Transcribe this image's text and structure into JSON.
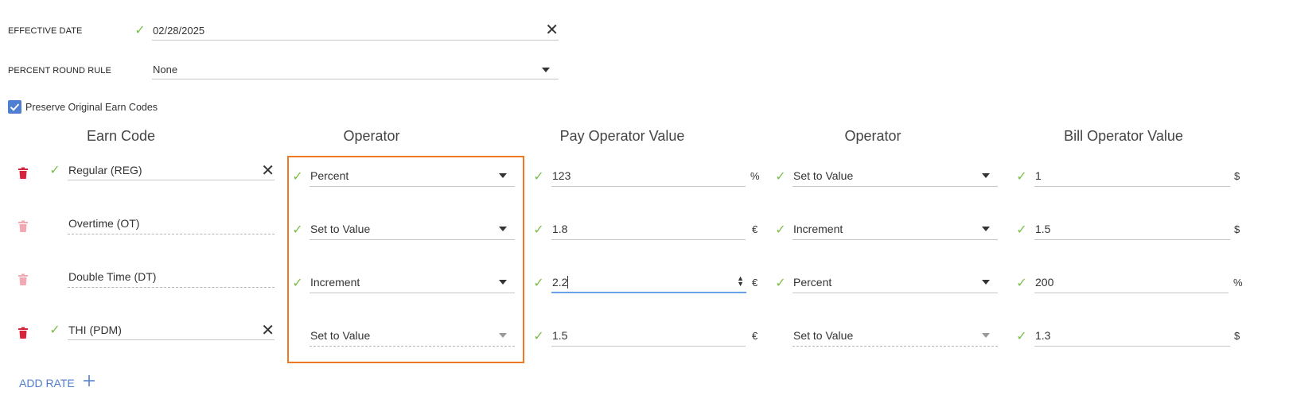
{
  "form": {
    "effective_date": {
      "label": "EFFECTIVE DATE",
      "value": "02/28/2025"
    },
    "percent_round_rule": {
      "label": "PERCENT ROUND RULE",
      "value": "None"
    },
    "preserve": {
      "label": "Preserve Original Earn Codes",
      "checked": true
    }
  },
  "headers": {
    "earn_code": "Earn Code",
    "operator_pay": "Operator",
    "pay_value": "Pay Operator Value",
    "operator_bill": "Operator",
    "bill_value": "Bill Operator Value"
  },
  "rows": [
    {
      "earn_code": "Regular (REG)",
      "pay_operator": "Percent",
      "pay_value": "123",
      "pay_unit": "%",
      "bill_operator": "Set to Value",
      "bill_value": "1",
      "bill_unit": "$"
    },
    {
      "earn_code": "Overtime (OT)",
      "pay_operator": "Set to Value",
      "pay_value": "1.8",
      "pay_unit": "€",
      "bill_operator": "Increment",
      "bill_value": "1.5",
      "bill_unit": "$"
    },
    {
      "earn_code": "Double Time (DT)",
      "pay_operator": "Increment",
      "pay_value": "2.2",
      "pay_unit": "€",
      "bill_operator": "Percent",
      "bill_value": "200",
      "bill_unit": "%"
    },
    {
      "earn_code": "THI (PDM)",
      "pay_operator": "Set to Value",
      "pay_value": "1.5",
      "pay_unit": "€",
      "bill_operator": "Set to Value",
      "bill_value": "1.3",
      "bill_unit": "$"
    }
  ],
  "actions": {
    "add_rate": "ADD RATE"
  },
  "icons": {
    "check": "check-icon",
    "close": "close-icon",
    "caret": "chevron-down-icon",
    "trash": "trash-icon",
    "plus": "plus-icon"
  },
  "colors": {
    "check": "#7cbf4a",
    "accent": "#4f7fd1",
    "trash_active": "#d9233a",
    "trash_disabled": "#f2a9b3",
    "highlight": "#f07a22"
  }
}
